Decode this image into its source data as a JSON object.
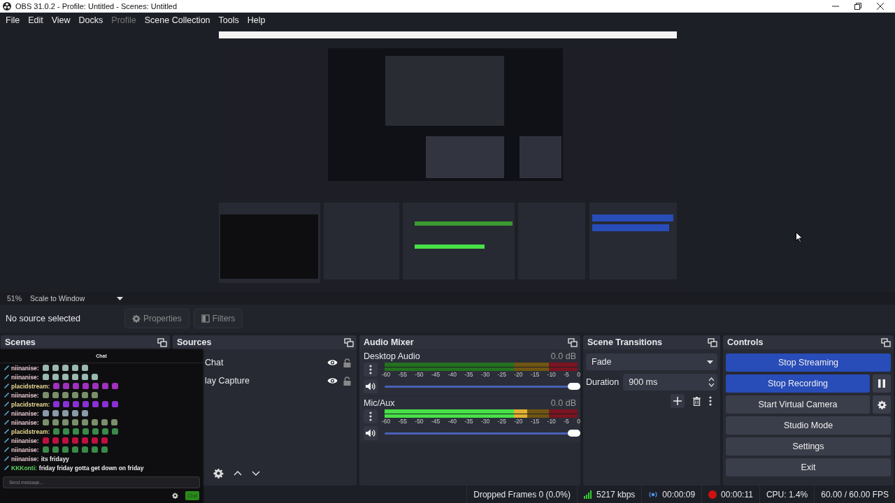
{
  "window": {
    "title": "OBS 31.0.2 - Profile: Untitled - Scenes: Untitled"
  },
  "menu": [
    {
      "label": "File",
      "disabled": false
    },
    {
      "label": "Edit",
      "disabled": false
    },
    {
      "label": "View",
      "disabled": false
    },
    {
      "label": "Docks",
      "disabled": false
    },
    {
      "label": "Profile",
      "disabled": true
    },
    {
      "label": "Scene Collection",
      "disabled": false
    },
    {
      "label": "Tools",
      "disabled": false
    },
    {
      "label": "Help",
      "disabled": false
    }
  ],
  "scale": {
    "zoom": "51%",
    "mode": "Scale to Window"
  },
  "context": {
    "status": "No source selected",
    "buttons": [
      {
        "label": "Properties",
        "kind": "properties"
      },
      {
        "label": "Filters",
        "kind": "filters"
      }
    ]
  },
  "scenes": {
    "title": "Scenes"
  },
  "sources": {
    "title": "Sources",
    "items": [
      {
        "name": "Chat",
        "visible": true,
        "locked": false
      },
      {
        "name": "lay Capture",
        "visible": true,
        "locked": false
      }
    ]
  },
  "audio_mixer": {
    "title": "Audio Mixer",
    "channels": [
      {
        "name": "Desktop Audio",
        "reading": "0.0 dB",
        "volume": {
          "level": 1
        },
        "scale": [
          "-60",
          "-55",
          "-50",
          "-45",
          "-40",
          "-35",
          "-30",
          "-25",
          "-20",
          "-15",
          "-10",
          "-5",
          "0"
        ]
      },
      {
        "name": "Mic/Aux",
        "reading": "0.0 dB",
        "meter": {
          "level": 0.74
        },
        "volume": {
          "level": 1
        },
        "scale": [
          "-60",
          "-55",
          "-50",
          "-45",
          "-40",
          "-35",
          "-30",
          "-25",
          "-20",
          "-15",
          "-10",
          "-5",
          "0"
        ]
      }
    ]
  },
  "transitions": {
    "title": "Scene Transitions",
    "transition": "Fade",
    "duration_label": "Duration",
    "duration": "900 ms"
  },
  "controls": {
    "title": "Controls",
    "buttons": [
      {
        "label": "Stop Streaming",
        "active": true,
        "kind": "plain"
      },
      {
        "label": "Stop Recording",
        "active": true,
        "kind": "pause"
      },
      {
        "label": "Start Virtual Camera",
        "active": false,
        "kind": "settings"
      },
      {
        "label": "Studio Mode",
        "active": false,
        "kind": "plain"
      },
      {
        "label": "Settings",
        "active": false,
        "kind": "plain"
      },
      {
        "label": "Exit",
        "active": false,
        "kind": "plain"
      }
    ]
  },
  "chat": {
    "title": "Chat",
    "messages": [
      {
        "user": "niinanise:",
        "color": "#e8c8d0",
        "emotes": [
          {
            "color": "#9ab8b0"
          },
          {
            "color": "#9ab8b0"
          },
          {
            "color": "#9ab8b0"
          },
          {
            "color": "#9ab8b0"
          },
          {
            "color": "#9ab8b0"
          }
        ]
      },
      {
        "user": "niinanise:",
        "color": "#e8c8d0",
        "emotes": [
          {
            "color": "#9ab8b0"
          },
          {
            "color": "#9ab8b0"
          },
          {
            "color": "#9ab8b0"
          },
          {
            "color": "#9ab8b0"
          },
          {
            "color": "#9ab8b0"
          },
          {
            "color": "#9ab8b0"
          }
        ]
      },
      {
        "user": "placidstream:",
        "color": "#e8d890",
        "emotes": [
          {
            "color": "#a030c0"
          },
          {
            "color": "#a030c0"
          },
          {
            "color": "#a030c0"
          },
          {
            "color": "#a030c0"
          },
          {
            "color": "#a030c0"
          },
          {
            "color": "#a030c0"
          },
          {
            "color": "#a030c0"
          }
        ]
      },
      {
        "user": "niinanise:",
        "color": "#e8c8d0",
        "emotes": [
          {
            "color": "#7a8f6a"
          },
          {
            "color": "#7a8f6a"
          },
          {
            "color": "#7a8f6a"
          },
          {
            "color": "#7a8f6a"
          },
          {
            "color": "#7a8f6a"
          },
          {
            "color": "#7a8f6a"
          }
        ]
      },
      {
        "user": "placidstream:",
        "color": "#e8d890",
        "emotes": [
          {
            "color": "#8a30d8"
          },
          {
            "color": "#8a30d8"
          },
          {
            "color": "#8a30d8"
          },
          {
            "color": "#8a30d8"
          },
          {
            "color": "#8a30d8"
          },
          {
            "color": "#8a30d8"
          },
          {
            "color": "#8a30d8"
          }
        ]
      },
      {
        "user": "niinanise:",
        "color": "#e8c8d0",
        "emotes": [
          {
            "color": "#8a9aa8"
          },
          {
            "color": "#8a9aa8"
          },
          {
            "color": "#8a9aa8"
          },
          {
            "color": "#8a9aa8"
          },
          {
            "color": "#8a9aa8"
          }
        ]
      },
      {
        "user": "niinanise:",
        "color": "#e8c8d0",
        "emotes": [
          {
            "color": "#7a8f6a"
          },
          {
            "color": "#7a8f6a"
          },
          {
            "color": "#7a8f6a"
          },
          {
            "color": "#7a8f6a"
          },
          {
            "color": "#7a8f6a"
          },
          {
            "color": "#7a8f6a"
          },
          {
            "color": "#7a8f6a"
          },
          {
            "color": "#7a8f6a"
          }
        ]
      },
      {
        "user": "placidstream:",
        "color": "#e8d890",
        "emotes": [
          {
            "color": "#3a8a4a"
          },
          {
            "color": "#3a8a4a"
          },
          {
            "color": "#3a8a4a"
          },
          {
            "color": "#3a8a4a"
          },
          {
            "color": "#3a8a4a"
          },
          {
            "color": "#3a8a4a"
          },
          {
            "color": "#3a8a4a"
          }
        ]
      },
      {
        "user": "niinanise:",
        "color": "#e8c8d0",
        "emotes": [
          {
            "color": "#c01040"
          },
          {
            "color": "#c01040"
          },
          {
            "color": "#c01040"
          },
          {
            "color": "#c01040"
          },
          {
            "color": "#c01040"
          },
          {
            "color": "#c01040"
          },
          {
            "color": "#c01040"
          }
        ]
      },
      {
        "user": "niinanise:",
        "color": "#e8c8d0",
        "emotes": [
          {
            "color": "#3a8a4a"
          },
          {
            "color": "#3a8a4a"
          },
          {
            "color": "#3a8a4a"
          },
          {
            "color": "#3a8a4a"
          },
          {
            "color": "#3a8a4a"
          },
          {
            "color": "#3a8a4a"
          },
          {
            "color": "#3a8a4a"
          }
        ]
      },
      {
        "user": "niinanise:",
        "color": "#e8c8d0",
        "text": "its fridayy"
      },
      {
        "user": "KKKonti:",
        "color": "#5fd35f",
        "text": "friday friday gotta get down on friday"
      }
    ],
    "placeholder": "Send message...",
    "send": "Chat"
  },
  "status_bar": {
    "dropped": "Dropped Frames 0 (0.0%)",
    "bitrate": "5217 kbps",
    "stream_time": "00:00:09",
    "record_time": "00:00:11",
    "cpu": "CPU: 1.4%",
    "fps": "60.00 / 60.00 FPS"
  }
}
